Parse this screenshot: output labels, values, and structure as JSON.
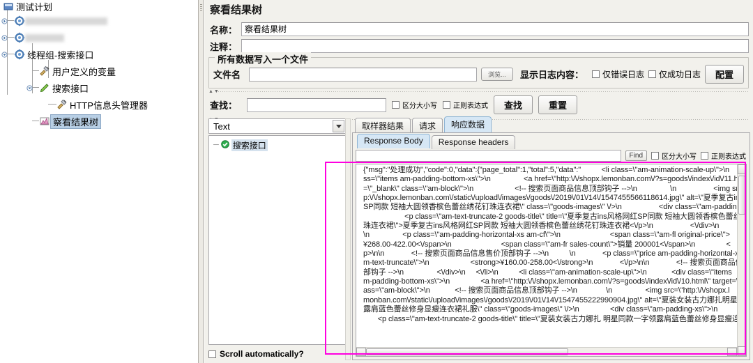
{
  "tree": {
    "root_label": "测试计划",
    "items": [
      {
        "label": "测试计划",
        "icon": "test-plan-icon",
        "indent": 0,
        "redacted": false
      },
      {
        "label": "",
        "icon": "thread-group-icon",
        "indent": 1,
        "redacted": true,
        "redact_width": 118
      },
      {
        "label": "",
        "icon": "thread-group-icon",
        "indent": 1,
        "redacted": true,
        "redact_width": 56
      },
      {
        "label": "线程组-搜索接口",
        "icon": "thread-group-icon",
        "indent": 1,
        "redacted": false
      },
      {
        "label": "用户定义的变量",
        "icon": "config-icon",
        "indent": 2,
        "redacted": false
      },
      {
        "label": "搜索接口",
        "icon": "sampler-icon",
        "indent": 2,
        "redacted": false
      },
      {
        "label": "HTTP信息头管理器",
        "icon": "config-icon",
        "indent": 3,
        "redacted": false
      },
      {
        "label": "察看结果树",
        "icon": "listener-icon",
        "indent": 2,
        "redacted": false,
        "selected": true
      }
    ]
  },
  "panel": {
    "title": "察看结果树",
    "name_label": "名称：",
    "name_value": "察看结果树",
    "comment_label": "注释：",
    "comment_value": "",
    "group_legend": "所有数据写入一个文件",
    "filename_label": "文件名",
    "filename_value": "",
    "browse_button": "浏览...",
    "log_display_label": "显示日志内容：",
    "error_log_checkbox": "仅错误日志",
    "success_log_checkbox": "仅成功日志",
    "configure_button": "配置",
    "search_label": "查找：",
    "search_value": "",
    "case_sensitive_checkbox": "区分大小写",
    "regex_checkbox": "正则表达式",
    "search_button": "查找",
    "reset_button": "重置"
  },
  "results": {
    "render_selector_value": "Text",
    "sampler_node_label": "搜索接口",
    "auto_scroll_label": "Scroll automatically?",
    "tabs": [
      {
        "label": "取样器结果",
        "active": false
      },
      {
        "label": "请求",
        "active": false
      },
      {
        "label": "响应数据",
        "active": true
      }
    ],
    "inner_tabs": [
      {
        "label": "Response Body",
        "active": true
      },
      {
        "label": "Response headers",
        "active": false
      }
    ],
    "find_value": "",
    "find_button": "Find",
    "find_case_checkbox": "区分大小写",
    "find_regex_checkbox": "正则表达式",
    "response_body": "{\"msg\":\"处理成功\",\"code\":0,\"data\":{\"page_total\":1,\"total\":5,\"data\":\"          <li class=\\\"am-animation-scale-up\\\">\\n                <div cl\nss=\\\"items am-padding-bottom-xs\\\">\\n                <a href=\\\"http:\\/\\/shopx.lemonban.com\\/?s=goods\\/index\\/id\\/11.html\\\" targe\n=\\\"_blank\\\" class=\\\"am-block\\\">\\n                    <!-- 搜索页面商品信息顶部钩子 -->\\n                \\n                  <img src=\\\"h\np:\\/\\/shopx.lemonban.com\\/static\\/upload\\/images\\/goods\\/2019\\/01\\/14\\/1547455566118614.jpg\\\" alt=\\\"夏季复古ins风格网红\nSP同款 短袖大圆领香槟色蕾丝绣花钉珠连衣裙\\\" class=\\\"goods-images\\\" \\/>\\n                  <div class=\\\"am-padding-xs\\\">\\\n                    <p class=\\\"am-text-truncate-2 goods-title\\\" title=\\\"夏季复古ins风格网红SP同款 短袖大圆领香槟色蕾丝绣花钉\n珠连衣裙\\\">夏季复古ins风格网红SP同款 短袖大圆领香槟色蕾丝绣花钉珠连衣裙<\\/p>\\n                  <\\/div>\\n           <\\/a\n\\n                <p class=\\\"am-padding-horizontal-xs am-cf\\\">\\n                        <span class=\\\"am-fl original-price\\\">\n¥268.00-422.00<\\/span>\\n                        <span class=\\\"am-fr sales-count\\\">销量 200001<\\/span>\\n               <\np>\\n\\n             <!-- 搜索页面商品信息售价顶部钩子 -->\\n          \\n             <p class=\\\"price am-padding-horizontal-xs\nm-text-truncate\\\">\\n                    <strong>¥160.00-258.00<\\/strong>\\n             <\\/p>\\n\\n             <!-- 搜索页面商品信息\n部钩子 -->\\n                <\\/div>\\n     <\\/li>\\n          <li class=\\\"am-animation-scale-up\\\">\\n            <div class=\\\"items\nm-padding-bottom-xs\\\">\\n               <a href=\\\"http:\\/\\/shopx.lemonban.com\\/?s=goods\\/index\\/id\\/10.html\\\" target=\\\"_blank\\\"\nass=\\\"am-block\\\">\\n            <!-- 搜索页面商品信息顶部钩子 -->\\n              \\n                <img src=\\\"http:\\/\\/shopx.l\nmonban.com\\/static\\/upload\\/images\\/goods\\/2019\\/01\\/14\\/1547455222990904.jpg\\\" alt=\\\"夏装女装古力娜扎明星同款一字领\n露肩蓝色蕾丝修身显瘦连衣裙礼服\\\" class=\\\"goods-images\\\" \\/>\\n               <div class=\\\"am-padding-xs\\\">\\n\n       <p class=\\\"am-text-truncate-2 goods-title\\\" title=\\\"夏装女装古力娜扎 明星同款一字领露肩蓝色蕾丝修身显瘦连衣裙礼服\\\">"
  },
  "colors": {
    "highlight": "#ff00e0",
    "tab_active": "#d6e7f5",
    "panel_bg": "#f2f1ec",
    "selection": "#b8cfe5"
  }
}
